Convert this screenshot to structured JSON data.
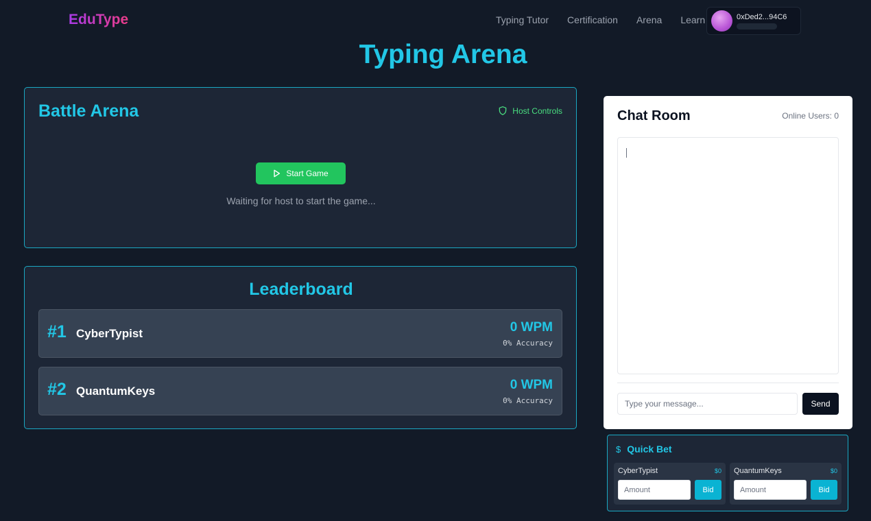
{
  "nav": {
    "logo": "EduType",
    "links": [
      "Typing Tutor",
      "Certification",
      "Arena",
      "Learn"
    ],
    "wallet_address": "0xDed2...94C6"
  },
  "page_title": "Typing Arena",
  "battle": {
    "title": "Battle Arena",
    "host_controls_label": "Host Controls",
    "start_button_label": "Start Game",
    "status_text": "Waiting for host to start the game..."
  },
  "leaderboard": {
    "title": "Leaderboard",
    "rows": [
      {
        "rank": "#1",
        "name": "CyberTypist",
        "wpm": "0 WPM",
        "accuracy": "0% Accuracy"
      },
      {
        "rank": "#2",
        "name": "QuantumKeys",
        "wpm": "0 WPM",
        "accuracy": "0% Accuracy"
      }
    ]
  },
  "chat": {
    "title": "Chat Room",
    "online_users": "Online Users: 0",
    "input_placeholder": "Type your message...",
    "send_label": "Send"
  },
  "quick_bet": {
    "icon": "dollar-icon",
    "title": "Quick Bet",
    "players": [
      {
        "name": "CyberTypist",
        "amount": "$0",
        "placeholder": "Amount",
        "bid_label": "Bid"
      },
      {
        "name": "QuantumKeys",
        "amount": "$0",
        "placeholder": "Amount",
        "bid_label": "Bid"
      }
    ]
  },
  "colors": {
    "accent": "#22c7e6",
    "start_button": "#22c55e",
    "host_controls": "#4ade80",
    "background": "#121a27",
    "panel": "#1d2636"
  }
}
